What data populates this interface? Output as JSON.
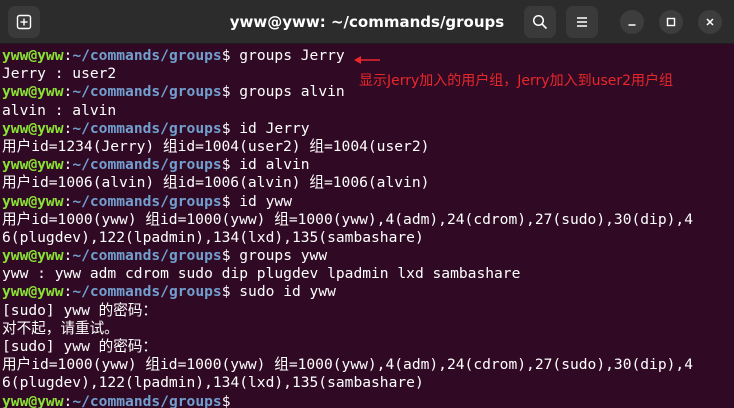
{
  "window": {
    "title": "yww@yww: ~/commands/groups",
    "controls": {
      "new_tab_icon": "new-tab-icon",
      "search_icon": "search-icon",
      "menu_icon": "hamburger-menu-icon",
      "minimize_icon": "minimize-icon",
      "maximize_icon": "maximize-icon",
      "close_icon": "close-icon"
    }
  },
  "colors": {
    "background": "#300a24",
    "titlebar": "#2c2c2c",
    "prompt_user": "#8ae234",
    "prompt_path": "#729fcf",
    "text": "#ffffff",
    "annotation": "#e8262c"
  },
  "prompt": {
    "user": "yww@yww",
    "colon": ":",
    "path": "~/commands/groups",
    "symbol": "$"
  },
  "lines": [
    {
      "type": "prompt",
      "cmd": " groups Jerry"
    },
    {
      "type": "output",
      "text": "Jerry : user2"
    },
    {
      "type": "prompt",
      "cmd": " groups alvin"
    },
    {
      "type": "output",
      "text": "alvin : alvin"
    },
    {
      "type": "prompt",
      "cmd": " id Jerry"
    },
    {
      "type": "output",
      "text": "用户id=1234(Jerry) 组id=1004(user2) 组=1004(user2)"
    },
    {
      "type": "prompt",
      "cmd": " id alvin"
    },
    {
      "type": "output",
      "text": "用户id=1006(alvin) 组id=1006(alvin) 组=1006(alvin)"
    },
    {
      "type": "prompt",
      "cmd": " id yww"
    },
    {
      "type": "output",
      "text": "用户id=1000(yww) 组id=1000(yww) 组=1000(yww),4(adm),24(cdrom),27(sudo),30(dip),4"
    },
    {
      "type": "output",
      "text": "6(plugdev),122(lpadmin),134(lxd),135(sambashare)"
    },
    {
      "type": "prompt",
      "cmd": " groups yww"
    },
    {
      "type": "output",
      "text": "yww : yww adm cdrom sudo dip plugdev lpadmin lxd sambashare"
    },
    {
      "type": "prompt",
      "cmd": " sudo id yww"
    },
    {
      "type": "output",
      "text": "[sudo] yww 的密码："
    },
    {
      "type": "output",
      "text": "对不起，请重试。"
    },
    {
      "type": "output",
      "text": "[sudo] yww 的密码："
    },
    {
      "type": "output",
      "text": "用户id=1000(yww) 组id=1000(yww) 组=1000(yww),4(adm),24(cdrom),27(sudo),30(dip),4"
    },
    {
      "type": "output",
      "text": "6(plugdev),122(lpadmin),134(lxd),135(sambashare)"
    },
    {
      "type": "prompt",
      "cmd": ""
    }
  ],
  "annotation": {
    "text": "显示Jerry加入的用户组，Jerry加入到user2用户组"
  }
}
